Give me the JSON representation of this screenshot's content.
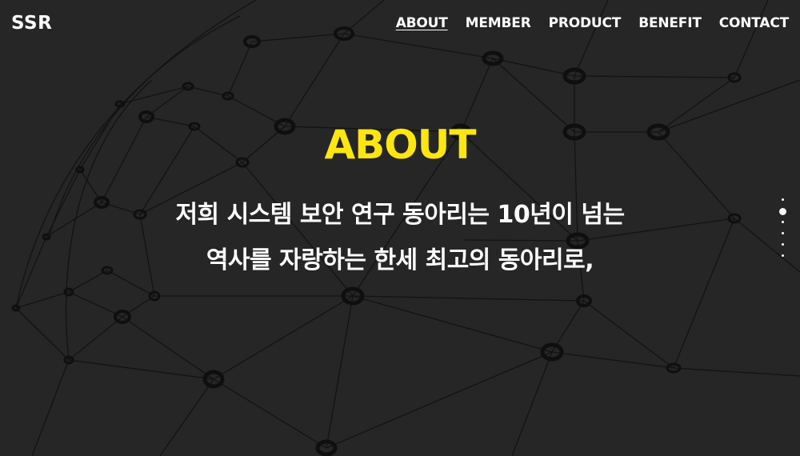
{
  "header": {
    "logo": "SSR",
    "nav": [
      {
        "label": "ABOUT",
        "active": true
      },
      {
        "label": "MEMBER",
        "active": false
      },
      {
        "label": "PRODUCT",
        "active": false
      },
      {
        "label": "BENEFIT",
        "active": false
      },
      {
        "label": "CONTACT",
        "active": false
      }
    ]
  },
  "hero": {
    "title": "ABOUT",
    "line1": "저희 시스템 보안 연구 동아리는 10년이 넘는",
    "line2": "역사를 자랑하는 한세 최고의 동아리로,"
  },
  "pager": {
    "count": 6,
    "active_index": 1
  },
  "colors": {
    "background": "#262626",
    "accent": "#ffe60f",
    "text": "#ffffff",
    "network": "#131313"
  }
}
